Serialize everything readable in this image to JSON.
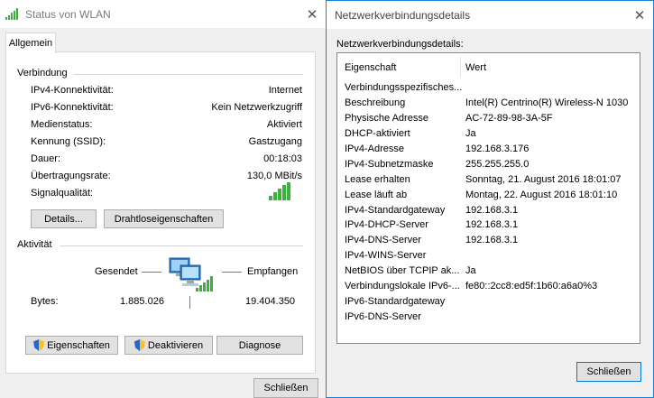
{
  "wlan": {
    "title": "Status von WLAN",
    "tab": "Allgemein",
    "section_connection": "Verbindung",
    "rows": [
      {
        "label": "IPv4-Konnektivität:",
        "value": "Internet"
      },
      {
        "label": "IPv6-Konnektivität:",
        "value": "Kein Netzwerkzugriff"
      },
      {
        "label": "Medienstatus:",
        "value": "Aktiviert"
      },
      {
        "label": "Kennung (SSID):",
        "value": "Gastzugang"
      },
      {
        "label": "Dauer:",
        "value": "00:18:03"
      },
      {
        "label": "Übertragungsrate:",
        "value": "130,0 MBit/s"
      }
    ],
    "signal_label": "Signalqualität:",
    "signal_bars": 5,
    "buttons": {
      "details": "Details...",
      "wireless": "Drahtloseigenschaften"
    },
    "section_activity": "Aktivität",
    "sent_label": "Gesendet",
    "received_label": "Empfangen",
    "bytes_label": "Bytes:",
    "bytes_sent": "1.885.026",
    "bytes_received": "19.404.350",
    "bottom_buttons": {
      "properties": "Eigenschaften",
      "disable": "Deaktivieren",
      "diagnose": "Diagnose"
    },
    "close_button": "Schließen"
  },
  "details": {
    "title": "Netzwerkverbindungsdetails",
    "heading": "Netzwerkverbindungsdetails:",
    "columns": {
      "property": "Eigenschaft",
      "value": "Wert"
    },
    "rows": [
      {
        "property": "Verbindungsspezifisches...",
        "value": ""
      },
      {
        "property": "Beschreibung",
        "value": "Intel(R) Centrino(R) Wireless-N 1030"
      },
      {
        "property": "Physische Adresse",
        "value": "AC-72-89-98-3A-5F"
      },
      {
        "property": "DHCP-aktiviert",
        "value": "Ja"
      },
      {
        "property": "IPv4-Adresse",
        "value": "192.168.3.176"
      },
      {
        "property": "IPv4-Subnetzmaske",
        "value": "255.255.255.0"
      },
      {
        "property": "Lease erhalten",
        "value": "Sonntag, 21. August 2016 18:01:07"
      },
      {
        "property": "Lease läuft ab",
        "value": "Montag, 22. August 2016 18:01:10"
      },
      {
        "property": "IPv4-Standardgateway",
        "value": "192.168.3.1"
      },
      {
        "property": "IPv4-DHCP-Server",
        "value": "192.168.3.1"
      },
      {
        "property": "IPv4-DNS-Server",
        "value": "192.168.3.1"
      },
      {
        "property": "IPv4-WINS-Server",
        "value": ""
      },
      {
        "property": "NetBIOS über TCPIP ak...",
        "value": "Ja"
      },
      {
        "property": "Verbindungslokale IPv6-...",
        "value": "fe80::2cc8:ed5f:1b60:a6a0%3"
      },
      {
        "property": "IPv6-Standardgateway",
        "value": ""
      },
      {
        "property": "IPv6-DNS-Server",
        "value": ""
      }
    ],
    "close_button": "Schließen"
  },
  "colors": {
    "accent": "#0078d7",
    "signal": "#3bb33b"
  }
}
